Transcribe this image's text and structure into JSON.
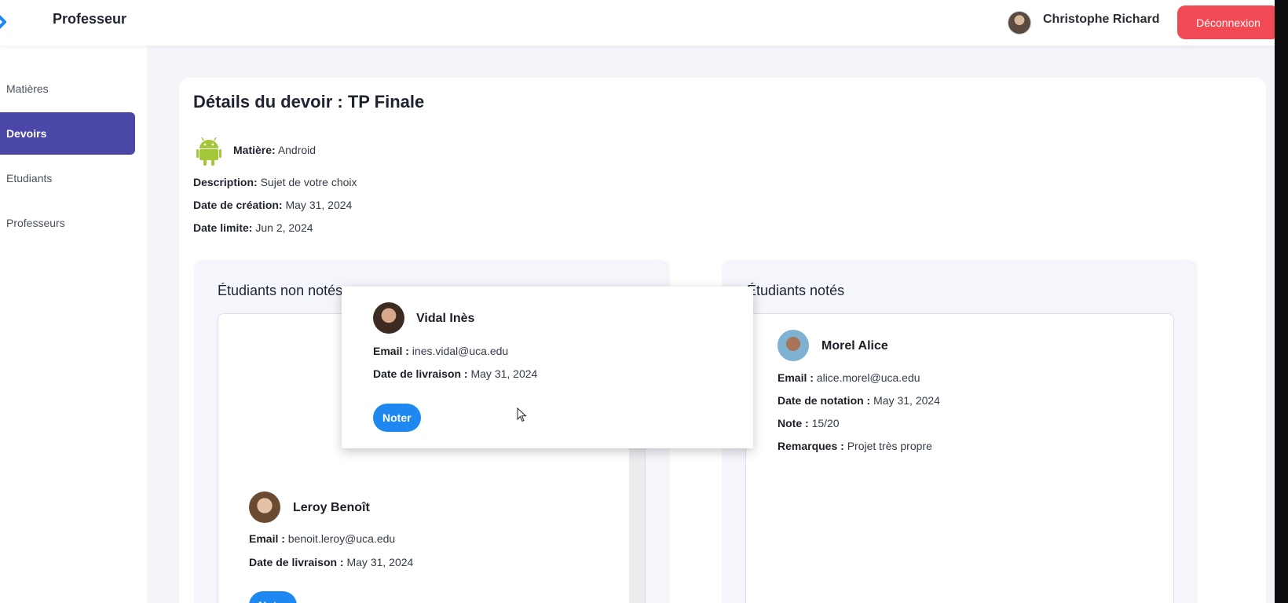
{
  "header": {
    "app_title": "Professeur",
    "user_name": "Christophe Richard",
    "logout_label": "Déconnexion"
  },
  "sidebar": {
    "items": [
      {
        "label": "Matières",
        "active": false
      },
      {
        "label": "Devoirs",
        "active": true
      },
      {
        "label": "Etudiants",
        "active": false
      },
      {
        "label": "Professeurs",
        "active": false
      }
    ]
  },
  "devoir": {
    "title": "Détails du devoir : TP Finale",
    "subject_label": "Matière:",
    "subject_value": "Android",
    "subject_icon": "android-icon",
    "description_label": "Description:",
    "description_value": "Sujet de votre choix",
    "created_label": "Date de création:",
    "created_value": "May 31, 2024",
    "deadline_label": "Date limite:",
    "deadline_value": "Jun 2, 2024"
  },
  "ungraded_panel": {
    "title": "Étudiants non notés",
    "students": [
      {
        "name": "Leroy Benoît",
        "email_label": "Email :",
        "email": "benoit.leroy@uca.edu",
        "delivery_label": "Date de livraison :",
        "delivery": "May 31, 2024",
        "action_label": "Noter"
      }
    ]
  },
  "dragged_card": {
    "name": "Vidal Inès",
    "email_label": "Email :",
    "email": "ines.vidal@uca.edu",
    "delivery_label": "Date de livraison :",
    "delivery": "May 31, 2024",
    "action_label": "Noter"
  },
  "graded_panel": {
    "title": "Étudiants notés",
    "students": [
      {
        "name": "Morel Alice",
        "email_label": "Email :",
        "email": "alice.morel@uca.edu",
        "graded_label": "Date de notation :",
        "graded": "May 31, 2024",
        "note_label": "Note :",
        "note": "15/20",
        "remarks_label": "Remarques :",
        "remarks": "Projet très propre"
      }
    ]
  },
  "colors": {
    "accent_sidebar": "#4b47a8",
    "logout_red": "#f24a55",
    "button_blue": "#1e88f0",
    "android_green": "#a4c639"
  }
}
